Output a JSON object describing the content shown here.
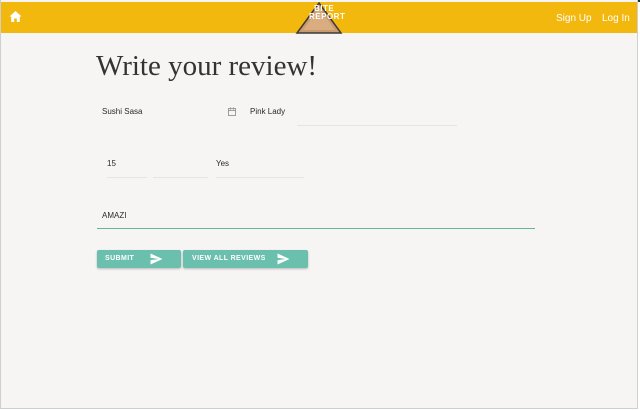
{
  "header": {
    "logo_line1": "BITE",
    "logo_line2": "REPORT",
    "signup_label": "Sign Up",
    "login_label": "Log In",
    "bar_color": "#f3b80e"
  },
  "form": {
    "title": "Write your review!",
    "restaurant_value": "Sushi Sasa",
    "dish_value": "Pink Lady",
    "price_value": "15",
    "recommend_value": "Yes",
    "review_value": "AMAZI",
    "accent_color": "#6bbfad"
  },
  "buttons": {
    "submit_label": "Submit",
    "view_all_label": "View all reviews"
  },
  "icons": {
    "home": "home-icon",
    "calendar": "calendar-icon",
    "send": "send-icon"
  }
}
